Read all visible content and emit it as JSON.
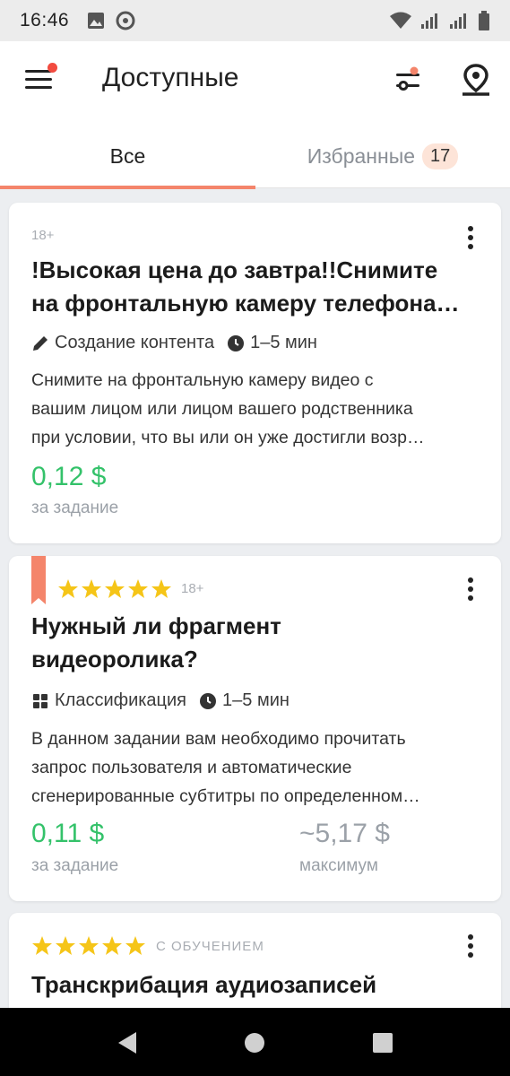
{
  "status_bar": {
    "time": "16:46"
  },
  "app_bar": {
    "title": "Доступные"
  },
  "tabs": [
    {
      "label": "Все",
      "active": true
    },
    {
      "label": "Избранные",
      "badge": "17",
      "active": false
    }
  ],
  "cards": [
    {
      "age": "18+",
      "title_line1": "!Высокая цена до завтра!!Снимите",
      "title_line2": "на фронтальную камеру телефона…",
      "category": "Создание контента",
      "duration": "1–5 мин",
      "desc_line1": "Снимите на фронтальную камеру видео с",
      "desc_line2": "вашим лицом или лицом вашего родственника",
      "desc_line3": "при условии, что вы или он уже достигли возр…",
      "price": "0,12 $",
      "price_label": "за задание"
    },
    {
      "age": "18+",
      "rating": 5,
      "bookmarked": true,
      "title_line1": "Нужный ли фрагмент",
      "title_line2": "видеоролика?",
      "category": "Классификация",
      "duration": "1–5 мин",
      "desc_line1": "В данном задании вам необходимо прочитать",
      "desc_line2": "запрос пользователя и автоматические",
      "desc_line3": "сгенерированные субтитры по определенном…",
      "price": "0,11 $",
      "price_label": "за задание",
      "max_price": "~5,17 $",
      "max_label": "максимум"
    },
    {
      "rating": 5,
      "tag": "С ОБУЧЕНИЕМ",
      "title_line1": "Транскрибация аудиозаписей"
    }
  ],
  "colors": {
    "accent": "#f4856b",
    "price_green": "#34c26a",
    "star": "#f5c518",
    "muted": "#9ba1a8"
  }
}
